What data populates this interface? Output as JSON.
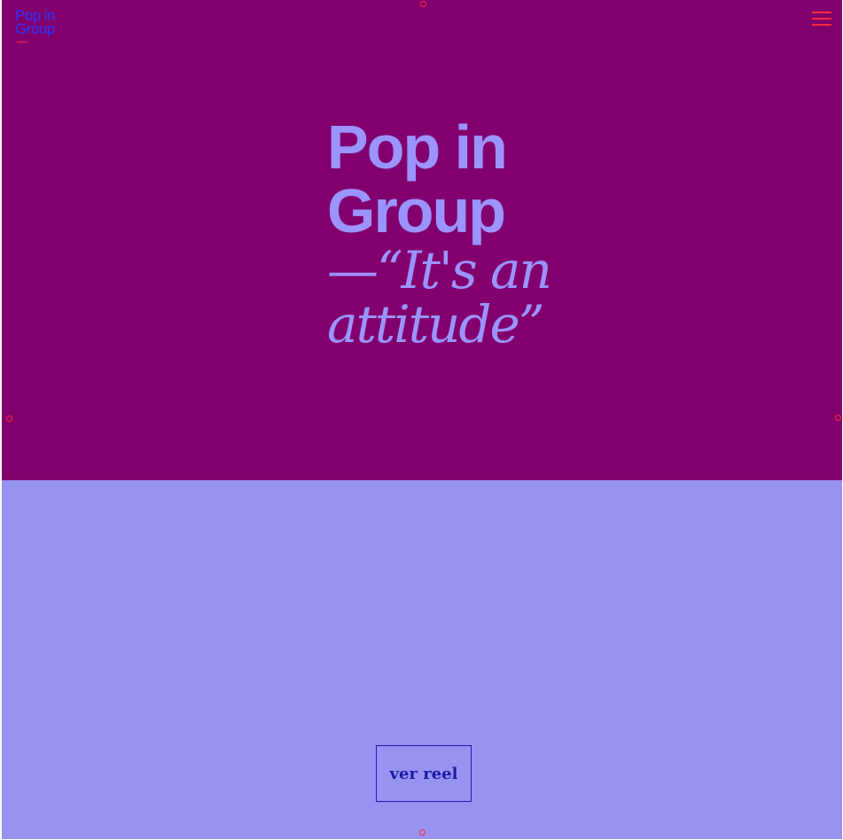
{
  "logo": {
    "line1": "Pop in",
    "line2": "Group"
  },
  "hero": {
    "brand_line1": "Pop in",
    "brand_line2": "Group",
    "tagline_line1": "—“It's an",
    "tagline_line2": "attitude”"
  },
  "cta": {
    "label": "ver reel"
  },
  "colors": {
    "hero_background": "#82006d",
    "page_background": "#9892f0",
    "accent_red": "#ff2a3a",
    "logo_blue": "#2a32ff",
    "headline_lavender": "#9b94ff",
    "button_text": "#1b1aa6"
  },
  "icons": {
    "menu": "hamburger-menu-icon",
    "markers": "circle-marker-icon"
  }
}
